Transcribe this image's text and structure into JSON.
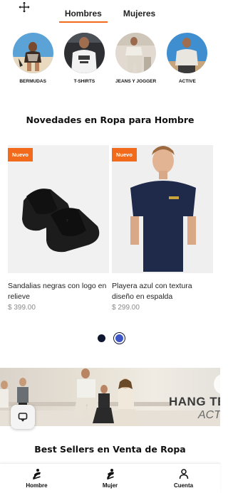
{
  "tabs": [
    {
      "label": "Hombres",
      "active": true
    },
    {
      "label": "Mujeres",
      "active": false
    }
  ],
  "categories": [
    {
      "label": "BERMUDAS",
      "icon": "bermudas-photo"
    },
    {
      "label": "T-SHIRTS",
      "icon": "tshirts-photo"
    },
    {
      "label": "JEANS Y JOGGER",
      "icon": "jeans-jogger-photo"
    },
    {
      "label": "ACTIVE",
      "icon": "active-photo"
    }
  ],
  "novedades": {
    "title": "Novedades en Ropa para Hombre",
    "products": [
      {
        "badge": "Nuevo",
        "name": "Sandalias negras con logo en relieve",
        "price": "$ 399.00"
      },
      {
        "badge": "Nuevo",
        "name": "Playera azul con textura diseño en espalda",
        "price": "$ 299.00"
      }
    ],
    "carousel_page": 2,
    "carousel_pages": 2
  },
  "banner": {
    "title": "HANG TE",
    "subtitle": "ACTI"
  },
  "best_sellers": {
    "title": "Best Sellers en Venta de Ropa"
  },
  "bottom_nav": [
    {
      "label": "Hombre",
      "icon": "men-silhouette-icon"
    },
    {
      "label": "Mujer",
      "icon": "women-silhouette-icon"
    },
    {
      "label": "Cuenta",
      "icon": "user-icon"
    }
  ],
  "colors": {
    "accent": "#f26a1b",
    "dot_dark": "#0e1630",
    "dot_active": "#3d55c5",
    "price": "#8a8a8a"
  }
}
